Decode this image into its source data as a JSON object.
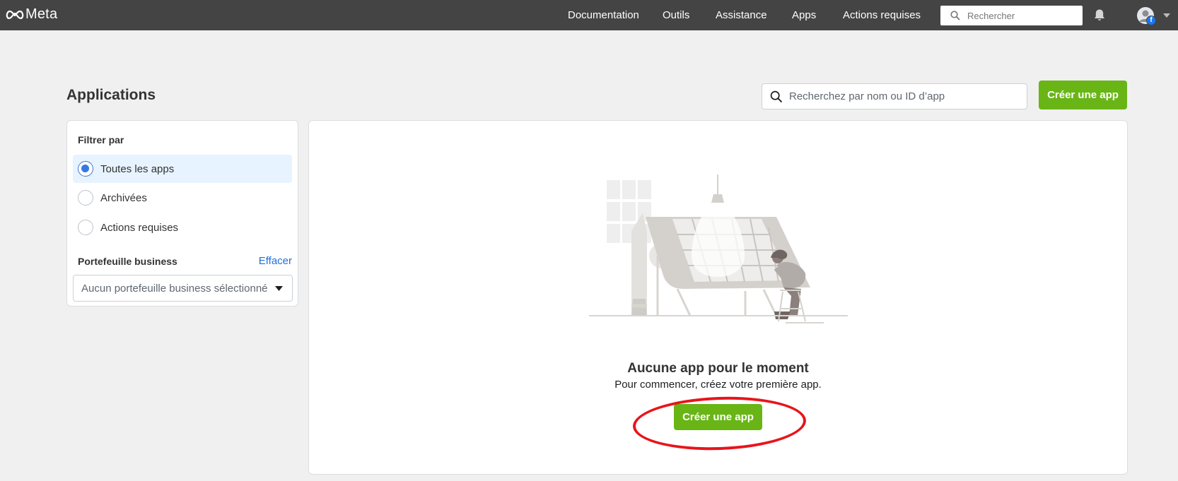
{
  "topbar": {
    "brand": "Meta",
    "nav": [
      "Documentation",
      "Outils",
      "Assistance",
      "Apps",
      "Actions requises"
    ],
    "search_placeholder": "Rechercher",
    "notification_icon": "bell-icon",
    "avatar_icon": "facebook-avatar-icon"
  },
  "header": {
    "title": "Applications",
    "search_placeholder": "Recherchez par nom ou ID d’app",
    "create_button": "Créer une app"
  },
  "filters": {
    "title": "Filtrer par",
    "options": [
      {
        "label": "Toutes les apps",
        "selected": true
      },
      {
        "label": "Archivées",
        "selected": false
      },
      {
        "label": "Actions requises",
        "selected": false
      }
    ],
    "business": {
      "title": "Portefeuille business",
      "clear_label": "Effacer",
      "select_value": "Aucun portefeuille business sélectionné"
    }
  },
  "empty_state": {
    "title": "Aucune app pour le moment",
    "subtitle": "Pour commencer, créez votre première app.",
    "button": "Créer une app"
  },
  "colors": {
    "topbar": "#444444",
    "accent_green": "#69b516",
    "link_blue": "#216fdb",
    "selected_bg": "#e7f3ff",
    "annotation_red": "#e8141b"
  }
}
